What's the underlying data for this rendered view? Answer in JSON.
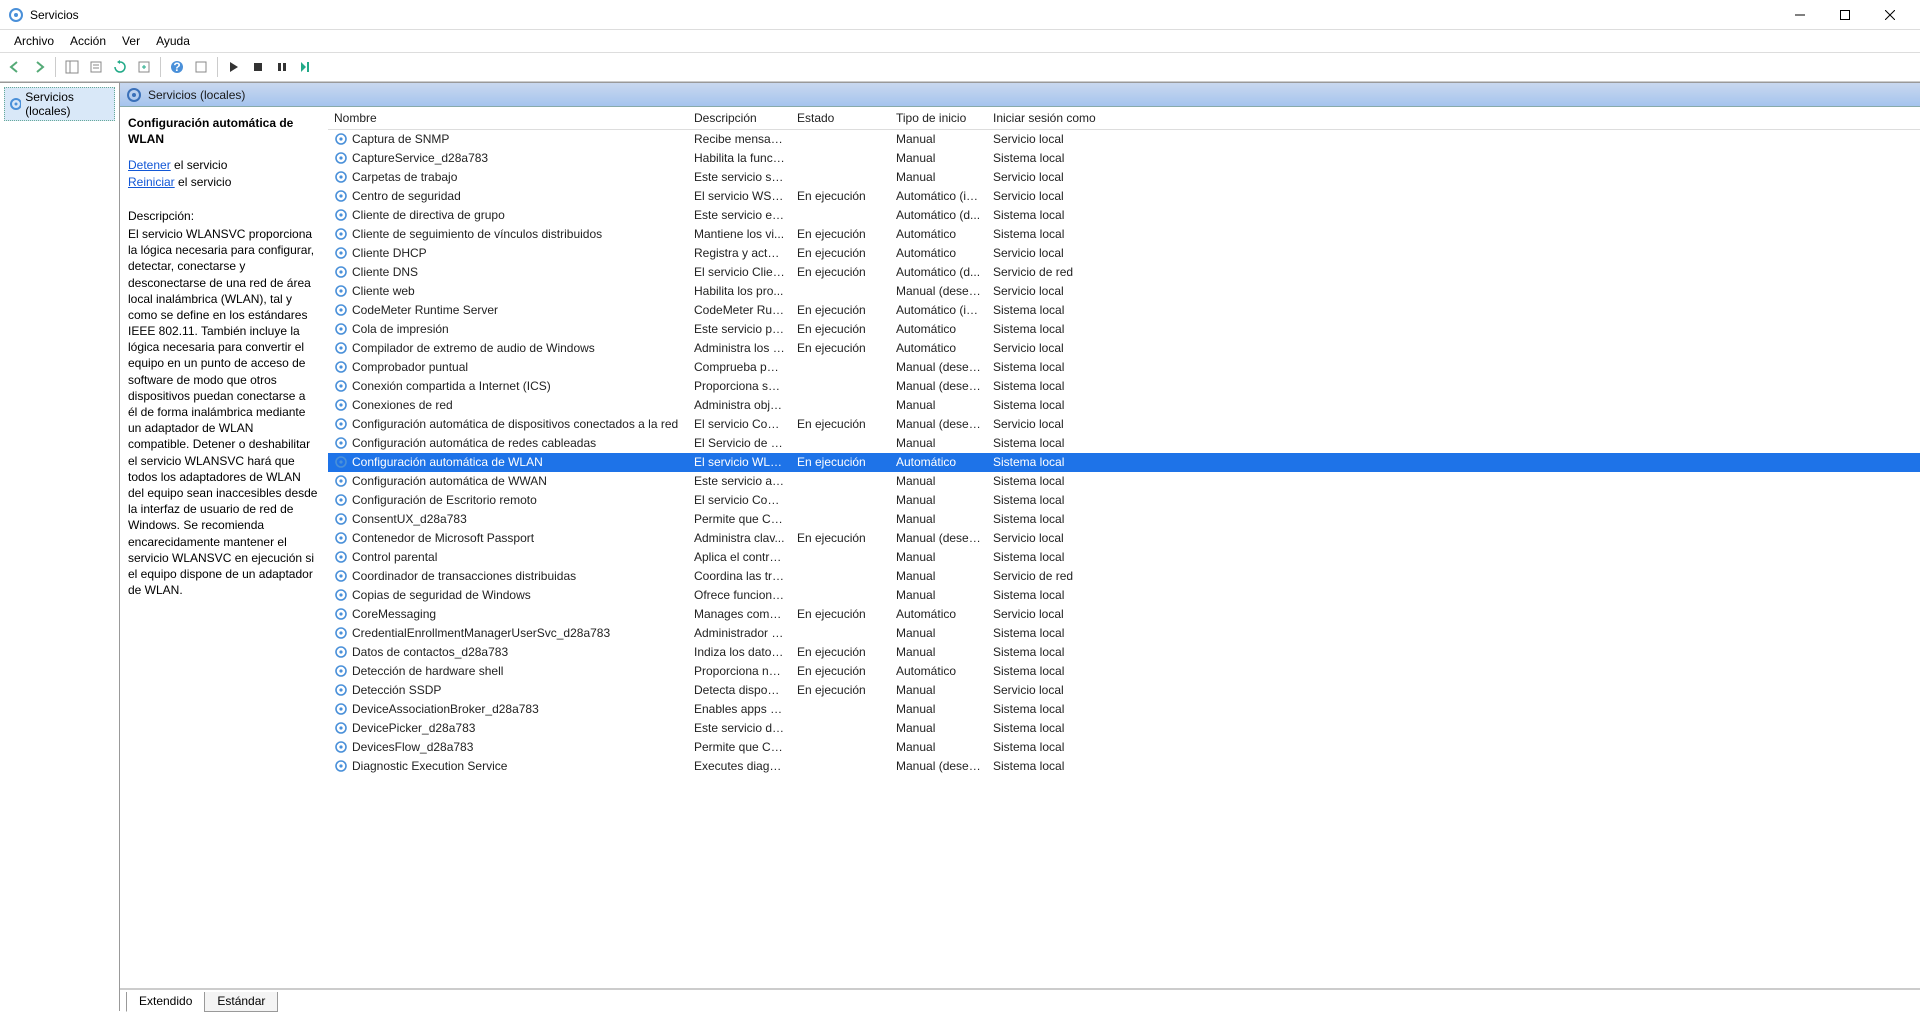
{
  "window": {
    "title": "Servicios"
  },
  "menu": {
    "file": "Archivo",
    "action": "Acción",
    "view": "Ver",
    "help": "Ayuda"
  },
  "tree": {
    "root": "Servicios (locales)"
  },
  "header": {
    "label": "Servicios (locales)"
  },
  "details": {
    "selected_title": "Configuración automática de WLAN",
    "stop_link": "Detener",
    "stop_suffix": " el servicio",
    "restart_link": "Reiniciar",
    "restart_suffix": " el servicio",
    "desc_label": "Descripción:",
    "desc_text": "El servicio WLANSVC proporciona la lógica necesaria para configurar, detectar, conectarse y desconectarse de una red de área local inalámbrica (WLAN), tal y como se define en los estándares IEEE 802.11. También incluye la lógica necesaria para convertir el equipo en un punto de acceso de software de modo que otros dispositivos puedan conectarse a él de forma inalámbrica mediante un adaptador de WLAN compatible. Detener o deshabilitar el servicio WLANSVC hará que todos los adaptadores de WLAN del equipo sean inaccesibles desde la interfaz de usuario de red de Windows. Se recomienda encarecidamente mantener el servicio WLANSVC en ejecución si el equipo dispone de un adaptador de WLAN."
  },
  "columns": {
    "name": "Nombre",
    "description": "Descripción",
    "state": "Estado",
    "start": "Tipo de inicio",
    "logon": "Iniciar sesión como"
  },
  "tabs": {
    "extended": "Extendido",
    "standard": "Estándar"
  },
  "services": [
    {
      "name": "Captura de SNMP",
      "desc": "Recibe mensaje...",
      "state": "",
      "start": "Manual",
      "logon": "Servicio local"
    },
    {
      "name": "CaptureService_d28a783",
      "desc": "Habilita la funci...",
      "state": "",
      "start": "Manual",
      "logon": "Sistema local"
    },
    {
      "name": "Carpetas de trabajo",
      "desc": "Este servicio sin...",
      "state": "",
      "start": "Manual",
      "logon": "Servicio local"
    },
    {
      "name": "Centro de seguridad",
      "desc": "El servicio WSCS...",
      "state": "En ejecución",
      "start": "Automático (in...",
      "logon": "Servicio local"
    },
    {
      "name": "Cliente de directiva de grupo",
      "desc": "Este servicio es r...",
      "state": "",
      "start": "Automático (d...",
      "logon": "Sistema local"
    },
    {
      "name": "Cliente de seguimiento de vínculos distribuidos",
      "desc": "Mantiene los vi...",
      "state": "En ejecución",
      "start": "Automático",
      "logon": "Sistema local"
    },
    {
      "name": "Cliente DHCP",
      "desc": "Registra y actua...",
      "state": "En ejecución",
      "start": "Automático",
      "logon": "Servicio local"
    },
    {
      "name": "Cliente DNS",
      "desc": "El servicio Client...",
      "state": "En ejecución",
      "start": "Automático (d...",
      "logon": "Servicio de red"
    },
    {
      "name": "Cliente web",
      "desc": "Habilita los pro...",
      "state": "",
      "start": "Manual (desen...",
      "logon": "Servicio local"
    },
    {
      "name": "CodeMeter Runtime Server",
      "desc": "CodeMeter Run...",
      "state": "En ejecución",
      "start": "Automático (in...",
      "logon": "Sistema local"
    },
    {
      "name": "Cola de impresión",
      "desc": "Este servicio po...",
      "state": "En ejecución",
      "start": "Automático",
      "logon": "Sistema local"
    },
    {
      "name": "Compilador de extremo de audio de Windows",
      "desc": "Administra los d...",
      "state": "En ejecución",
      "start": "Automático",
      "logon": "Servicio local"
    },
    {
      "name": "Comprobador puntual",
      "desc": "Comprueba pos...",
      "state": "",
      "start": "Manual (desen...",
      "logon": "Sistema local"
    },
    {
      "name": "Conexión compartida a Internet (ICS)",
      "desc": "Proporciona ser...",
      "state": "",
      "start": "Manual (desen...",
      "logon": "Sistema local"
    },
    {
      "name": "Conexiones de red",
      "desc": "Administra obje...",
      "state": "",
      "start": "Manual",
      "logon": "Sistema local"
    },
    {
      "name": "Configuración automática de dispositivos conectados a la red",
      "desc": "El servicio Confi...",
      "state": "En ejecución",
      "start": "Manual (desen...",
      "logon": "Servicio local"
    },
    {
      "name": "Configuración automática de redes cableadas",
      "desc": "El Servicio de co...",
      "state": "",
      "start": "Manual",
      "logon": "Sistema local"
    },
    {
      "name": "Configuración automática de WLAN",
      "desc": "El servicio WLA...",
      "state": "En ejecución",
      "start": "Automático",
      "logon": "Sistema local",
      "selected": true
    },
    {
      "name": "Configuración automática de WWAN",
      "desc": "Este servicio ad...",
      "state": "",
      "start": "Manual",
      "logon": "Sistema local"
    },
    {
      "name": "Configuración de Escritorio remoto",
      "desc": "El servicio Confi...",
      "state": "",
      "start": "Manual",
      "logon": "Sistema local"
    },
    {
      "name": "ConsentUX_d28a783",
      "desc": "Permite que Co...",
      "state": "",
      "start": "Manual",
      "logon": "Sistema local"
    },
    {
      "name": "Contenedor de Microsoft Passport",
      "desc": "Administra clav...",
      "state": "En ejecución",
      "start": "Manual (desen...",
      "logon": "Servicio local"
    },
    {
      "name": "Control parental",
      "desc": "Aplica el control...",
      "state": "",
      "start": "Manual",
      "logon": "Sistema local"
    },
    {
      "name": "Coordinador de transacciones distribuidas",
      "desc": "Coordina las tra...",
      "state": "",
      "start": "Manual",
      "logon": "Servicio de red"
    },
    {
      "name": "Copias de seguridad de Windows",
      "desc": "Ofrece funciona...",
      "state": "",
      "start": "Manual",
      "logon": "Sistema local"
    },
    {
      "name": "CoreMessaging",
      "desc": "Manages comm...",
      "state": "En ejecución",
      "start": "Automático",
      "logon": "Servicio local"
    },
    {
      "name": "CredentialEnrollmentManagerUserSvc_d28a783",
      "desc": "Administrador d...",
      "state": "",
      "start": "Manual",
      "logon": "Sistema local"
    },
    {
      "name": "Datos de contactos_d28a783",
      "desc": "Indiza los datos ...",
      "state": "En ejecución",
      "start": "Manual",
      "logon": "Sistema local"
    },
    {
      "name": "Detección de hardware shell",
      "desc": "Proporciona not...",
      "state": "En ejecución",
      "start": "Automático",
      "logon": "Sistema local"
    },
    {
      "name": "Detección SSDP",
      "desc": "Detecta disposit...",
      "state": "En ejecución",
      "start": "Manual",
      "logon": "Servicio local"
    },
    {
      "name": "DeviceAssociationBroker_d28a783",
      "desc": "Enables apps to...",
      "state": "",
      "start": "Manual",
      "logon": "Sistema local"
    },
    {
      "name": "DevicePicker_d28a783",
      "desc": "Este servicio de ...",
      "state": "",
      "start": "Manual",
      "logon": "Sistema local"
    },
    {
      "name": "DevicesFlow_d28a783",
      "desc": "Permite que Co...",
      "state": "",
      "start": "Manual",
      "logon": "Sistema local"
    },
    {
      "name": "Diagnostic Execution Service",
      "desc": "Executes diagno...",
      "state": "",
      "start": "Manual (desen...",
      "logon": "Sistema local"
    }
  ]
}
